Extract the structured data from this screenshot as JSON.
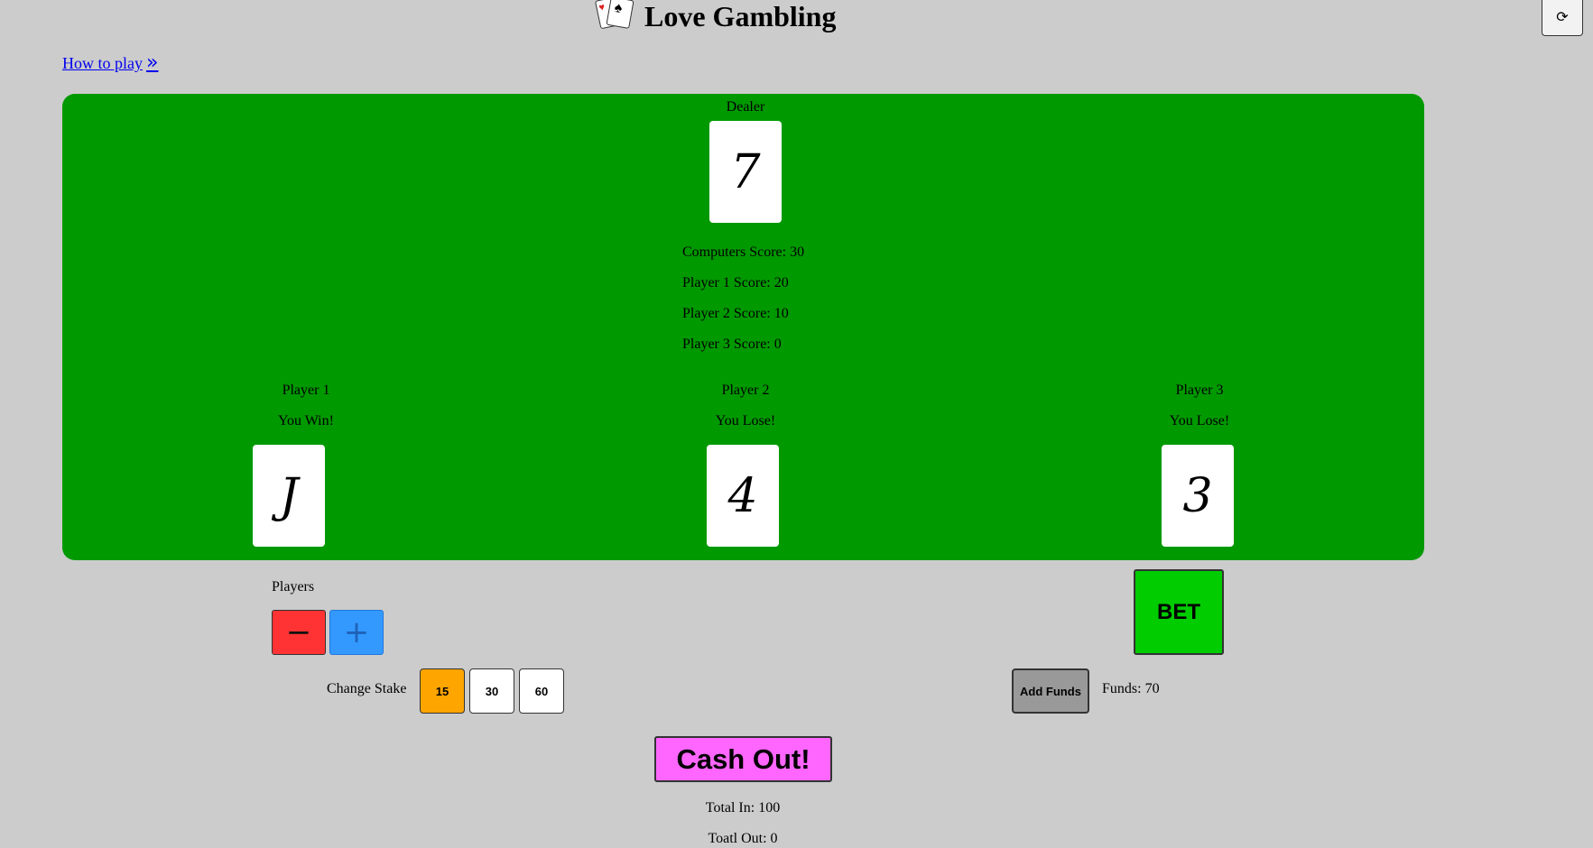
{
  "header": {
    "title": "Love Gambling",
    "logo_icon": "playing-cards-icon",
    "refresh_icon": "refresh-icon",
    "refresh_glyph": "⟳"
  },
  "howto": {
    "label": "How to play",
    "icon": "double-chevron-right-icon",
    "glyph": "»"
  },
  "table": {
    "color": "#009900",
    "dealer": {
      "label": "Dealer",
      "card": "7"
    },
    "scores": [
      "Computers Score: 30",
      "Player 1 Score: 20",
      "Player 2 Score: 10",
      "Player 3 Score: 0"
    ],
    "players": [
      {
        "label": "Player 1",
        "result": "You Win!",
        "card": "J"
      },
      {
        "label": "Player 2",
        "result": "You Lose!",
        "card": "4"
      },
      {
        "label": "Player 3",
        "result": "You Lose!",
        "card": "3"
      }
    ]
  },
  "controls": {
    "players_label": "Players",
    "minus_glyph": "−",
    "plus_glyph": "+",
    "bet_label": "BET",
    "stake_label": "Change Stake",
    "stakes": [
      "15",
      "30",
      "60"
    ],
    "selected_stake": "15",
    "add_funds_label": "Add Funds",
    "funds_text": "Funds: 70",
    "cashout_label": "Cash Out!",
    "total_in": "Total In: 100",
    "total_out": "Toatl Out: 0"
  },
  "colors": {
    "background": "#cccccc",
    "minus": "#ff3333",
    "plus": "#3399ff",
    "bet": "#00cc00",
    "stake_selected": "#ffa500",
    "add_funds": "#999999",
    "cashout": "#ff66ff",
    "link": "#0000ee"
  }
}
